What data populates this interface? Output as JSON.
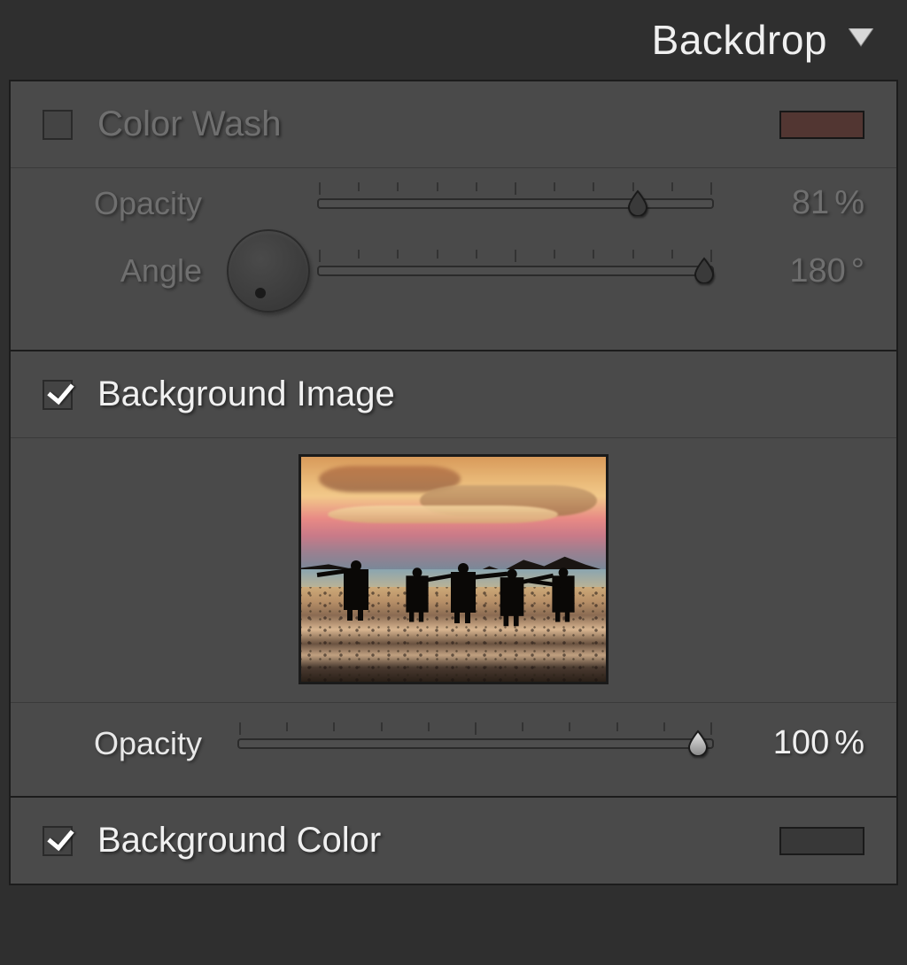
{
  "panel": {
    "title": "Backdrop"
  },
  "colorWash": {
    "enabled": false,
    "title": "Color Wash",
    "swatchColor": "#7a3a36",
    "opacity": {
      "label": "Opacity",
      "value": 81,
      "unit": "%"
    },
    "angle": {
      "label": "Angle",
      "value": 180,
      "unit": "°"
    }
  },
  "backgroundImage": {
    "enabled": true,
    "title": "Background Image",
    "opacity": {
      "label": "Opacity",
      "value": 100,
      "unit": "%"
    }
  },
  "backgroundColor": {
    "enabled": true,
    "title": "Background Color",
    "swatchColor": "#383838"
  }
}
